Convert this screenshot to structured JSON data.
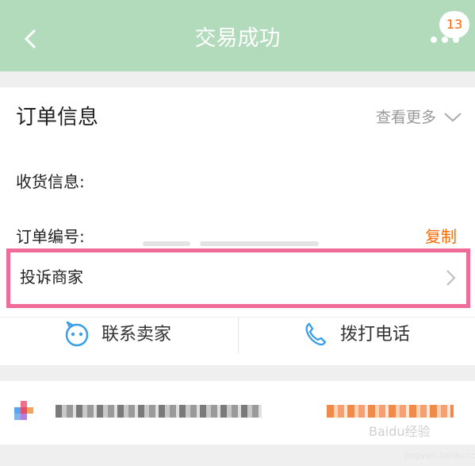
{
  "header": {
    "title": "交易成功",
    "badge_count": "13",
    "background_color": "#b2dbbb"
  },
  "order_info": {
    "section_title": "订单信息",
    "more_label": "查看更多",
    "shipping_label": "收货信息:",
    "order_number_label": "订单编号:",
    "copy_label": "复制",
    "accent_color": "#ff6a00"
  },
  "complaint": {
    "label": "投诉商家",
    "highlight_color": "#f16b98"
  },
  "actions": {
    "contact_seller": "联系卖家",
    "call_phone": "拨打电话",
    "icon_color": "#3a9ee8"
  },
  "watermark": {
    "text": "Baidu经验",
    "sub": "jingyan.baidu.com"
  }
}
